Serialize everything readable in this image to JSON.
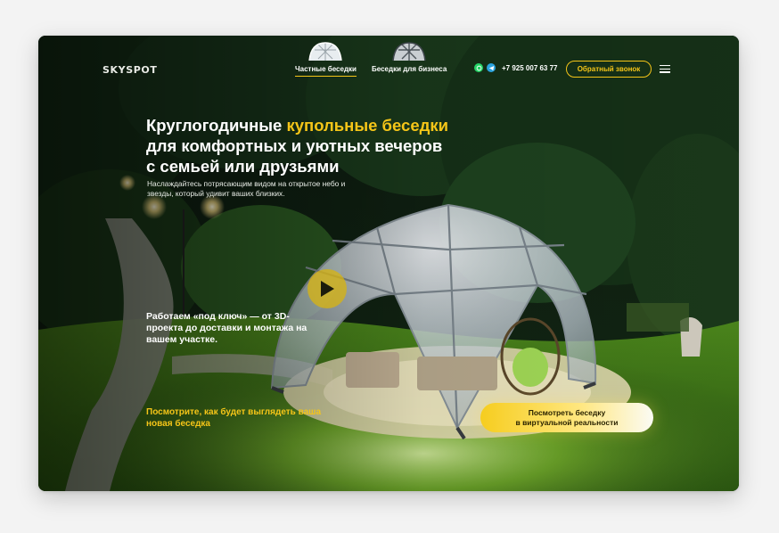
{
  "header": {
    "logo": "SKYSPOT",
    "nav": [
      {
        "label": "Частные беседки",
        "active": true
      },
      {
        "label": "Беседки для бизнеса",
        "active": false
      }
    ],
    "phone": "+7 925 007 63 77",
    "contact_icons": [
      "whatsapp-icon",
      "telegram-icon"
    ],
    "callback_label": "Обратный звонок"
  },
  "hero": {
    "title_part1": "Круглогодичные ",
    "title_accent": "купольные беседки",
    "title_part2": "для комфортных и уютных вечеров",
    "title_part3": "с семьей или друзьями",
    "subtitle": "Наслаждайтесь потрясающим видом на открытое небо и звезды, который удивит ваших близких.",
    "turnkey": "Работаем «под ключ» — от 3D-проекта до доставки и монтажа на вашем участке.",
    "vr_link": "Посмотрите, как будет выглядеть ваша новая беседка",
    "vr_button_line1": "Посмотреть беседку",
    "vr_button_line2": "в виртуальной реальности"
  },
  "colors": {
    "accent": "#f5c518",
    "text": "#ffffff",
    "background": "#0b1a10"
  }
}
